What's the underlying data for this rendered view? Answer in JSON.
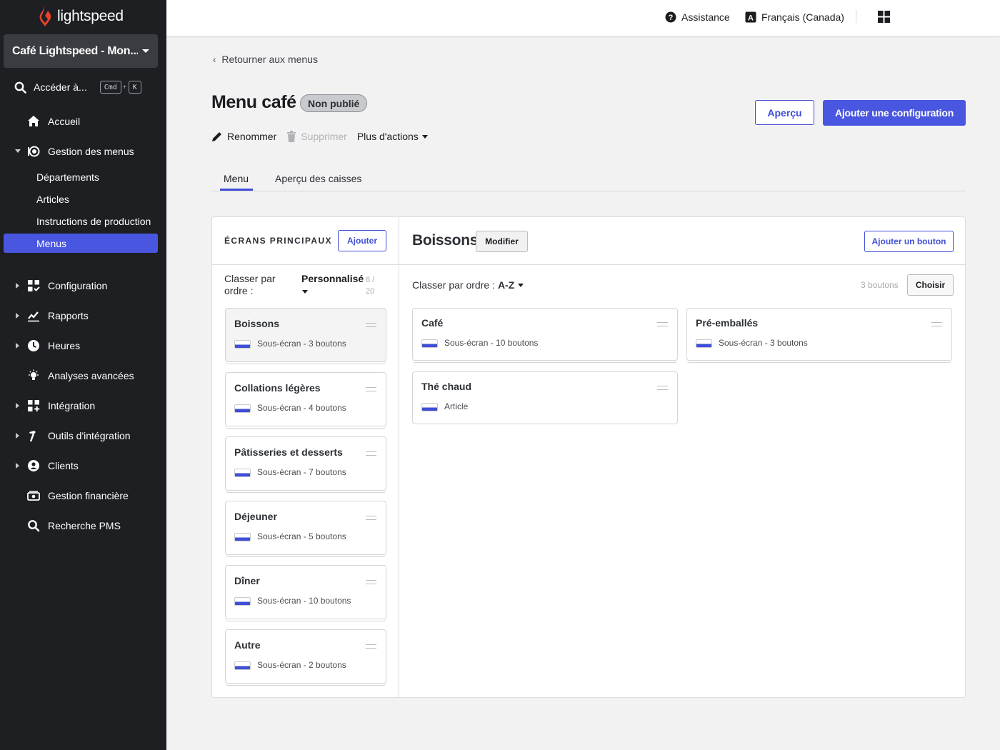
{
  "brand": {
    "logo_text": "lightspeed",
    "accent": "#4856e0",
    "logo_color": "#e8412b"
  },
  "store": {
    "name": "Café Lightspeed - Mon..."
  },
  "search": {
    "label": "Accéder à...",
    "key1": "Cmd",
    "plus": "+",
    "key2": "K"
  },
  "nav": {
    "accueil": "Accueil",
    "gestion_menus": "Gestion des menus",
    "sub": [
      "Départements",
      "Articles",
      "Instructions de production",
      "Menus"
    ],
    "configuration": "Configuration",
    "rapports": "Rapports",
    "heures": "Heures",
    "analyses": "Analyses avancées",
    "integration": "Intégration",
    "outils": "Outils d'intégration",
    "clients": "Clients",
    "finance": "Gestion financière",
    "pms": "Recherche PMS"
  },
  "topbar": {
    "help": "Assistance",
    "language": "Français (Canada)"
  },
  "page": {
    "back": "Retourner aux menus",
    "title": "Menu café",
    "status": "Non publié",
    "rename": "Renommer",
    "delete": "Supprimer",
    "more": "Plus d'actions",
    "preview": "Aperçu",
    "add_config": "Ajouter une configuration"
  },
  "tabs": [
    "Menu",
    "Aperçu des caisses"
  ],
  "left_panel": {
    "heading": "ÉCRANS PRINCIPAUX",
    "add": "Ajouter",
    "sort_label": "Classer par ordre :",
    "sort_value": "Personnalisé",
    "count": "6 / 20",
    "screens": [
      {
        "name": "Boissons",
        "sub": "Sous-écran - 3 boutons"
      },
      {
        "name": "Collations légères",
        "sub": "Sous-écran - 4 boutons"
      },
      {
        "name": "Pâtisseries et desserts",
        "sub": "Sous-écran - 7 boutons"
      },
      {
        "name": "Déjeuner",
        "sub": "Sous-écran - 5 boutons"
      },
      {
        "name": "Dîner",
        "sub": "Sous-écran - 10 boutons"
      },
      {
        "name": "Autre",
        "sub": "Sous-écran - 2 boutons"
      }
    ]
  },
  "right_panel": {
    "title": "Boissons",
    "edit": "Modifier",
    "add_button": "Ajouter un bouton",
    "sort_label": "Classer par ordre :",
    "sort_value": "A-Z",
    "count": "3 boutons",
    "choose": "Choisir",
    "buttons": [
      {
        "name": "Café",
        "sub": "Sous-écran - 10 boutons"
      },
      {
        "name": "Pré-emballés",
        "sub": "Sous-écran - 3 boutons"
      },
      {
        "name": "Thé chaud",
        "sub": "Article"
      }
    ]
  }
}
